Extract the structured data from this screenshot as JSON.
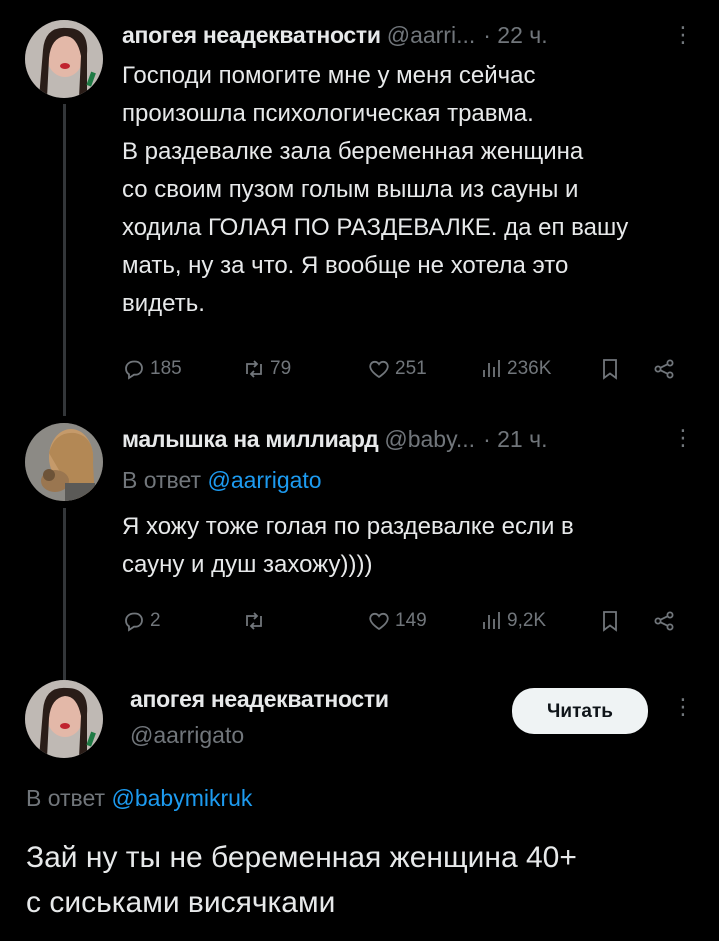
{
  "tweet1": {
    "author": "апогея неадекватности",
    "handle": "@aarri...",
    "time": "· 22 ч.",
    "more": "⋮",
    "lines": [
      "Господи помогите мне у меня сейчас",
      "произошла психологическая травма.",
      "В раздевалке зала беременная женщина",
      "со своим пузом голым вышла из сауны и",
      "ходила ГОЛАЯ ПО РАЗДЕВАЛКЕ. да еп вашу",
      "мать, ну за что. Я вообще не хотела это",
      "видеть."
    ],
    "stats": {
      "replies": "185",
      "retweets": "79",
      "likes": "251",
      "views": "236K"
    }
  },
  "tweet2": {
    "author": "малышка на миллиард",
    "handle": "@baby...",
    "time": "· 21 ч.",
    "more": "⋮",
    "reply_prefix": "В ответ",
    "reply_to": "@aarrigato",
    "lines": [
      "Я хожу тоже голая по раздевалке если в",
      "сауну и душ захожу))))"
    ],
    "stats": {
      "replies": "2",
      "retweets": "",
      "likes": "149",
      "views": "9,2K"
    }
  },
  "tweet3": {
    "author": "апогея неадекватности",
    "handle": "@aarrigato",
    "follow_label": "Читать",
    "more": "⋮",
    "reply_prefix": "В ответ",
    "reply_to": "@babymikruk",
    "lines": [
      "Зай ну ты не беременная женщина 40+",
      "с сиськами висячками"
    ]
  },
  "colors": {
    "background": "#000000",
    "text": "#e7e9ea",
    "muted": "#71767b",
    "link": "#1d9bf0",
    "line": "#333639"
  }
}
